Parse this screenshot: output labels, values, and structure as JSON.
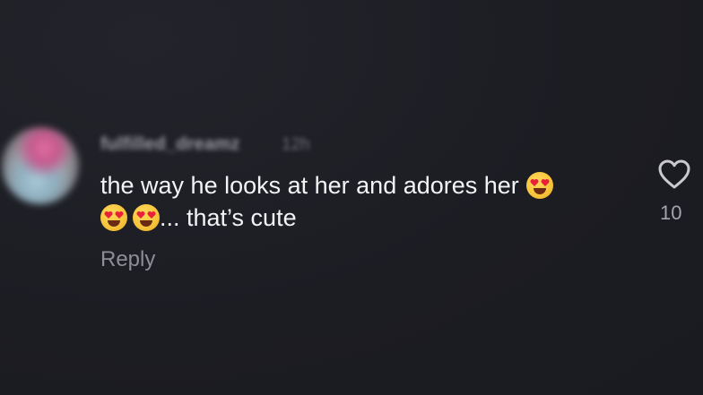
{
  "comment": {
    "username": "fulfilled_dreamz",
    "timestamp": "12h",
    "text_line1": "the way he looks at her and adores her",
    "text_line2": "... that’s cute",
    "emoji_name": "heart-eyes-emoji",
    "reply_label": "Reply",
    "like_count": "10"
  },
  "icons": {
    "like": "heart-outline-icon"
  },
  "colors": {
    "background": "#1d1e24",
    "text": "#f3f3f5",
    "secondary_text": "#8e8e96",
    "emoji_face": "#f6c33a",
    "emoji_heart": "#e8203a"
  }
}
